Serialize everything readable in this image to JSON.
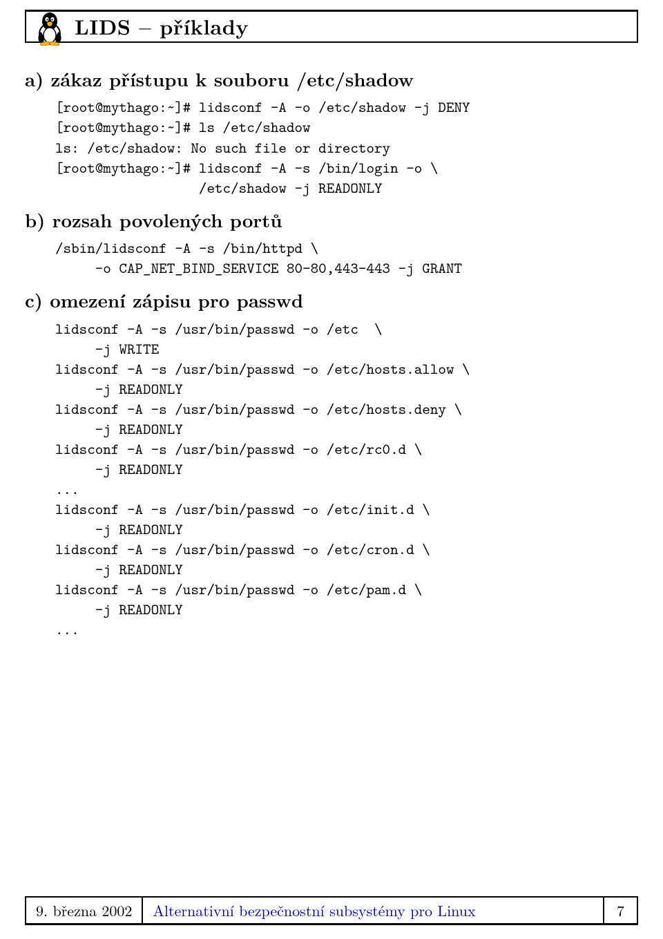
{
  "header": {
    "title": "LIDS – příklady"
  },
  "sections": {
    "a": {
      "heading": "a) zákaz přístupu k souboru /etc/shadow",
      "code": "[root@mythago:~]# lidsconf -A -o /etc/shadow -j DENY\n[root@mythago:~]# ls /etc/shadow\nls: /etc/shadow: No such file or directory\n[root@mythago:~]# lidsconf -A -s /bin/login -o \\\n                  /etc/shadow -j READONLY"
    },
    "b": {
      "heading": "b) rozsah povolených portů",
      "code": "/sbin/lidsconf -A -s /bin/httpd \\\n     -o CAP_NET_BIND_SERVICE 80-80,443-443 -j GRANT"
    },
    "c": {
      "heading": "c) omezení zápisu pro passwd",
      "code": "lidsconf -A -s /usr/bin/passwd -o /etc  \\\n     -j WRITE\nlidsconf -A -s /usr/bin/passwd -o /etc/hosts.allow \\\n     -j READONLY\nlidsconf -A -s /usr/bin/passwd -o /etc/hosts.deny \\\n     -j READONLY\nlidsconf -A -s /usr/bin/passwd -o /etc/rc0.d \\\n     -j READONLY\n...\nlidsconf -A -s /usr/bin/passwd -o /etc/init.d \\\n     -j READONLY\nlidsconf -A -s /usr/bin/passwd -o /etc/cron.d \\\n     -j READONLY\nlidsconf -A -s /usr/bin/passwd -o /etc/pam.d \\\n     -j READONLY\n..."
    }
  },
  "footer": {
    "date": "9. března 2002",
    "doc_title": "Alternativní bezpečnostní subsystémy pro Linux",
    "page": "7"
  }
}
